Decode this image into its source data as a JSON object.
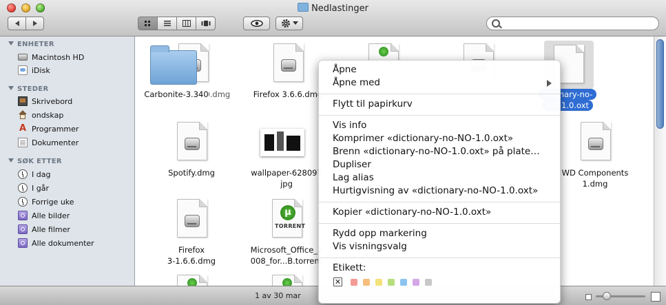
{
  "window": {
    "title": "Nedlastinger"
  },
  "toolbar": {
    "back_icon": "back-arrow",
    "forward_icon": "forward-arrow",
    "view_modes": [
      "icon-view",
      "list-view",
      "column-view",
      "coverflow-view"
    ],
    "active_view": "icon-view",
    "quicklook_icon": "eye",
    "action_icon": "gear",
    "search": {
      "value": "",
      "placeholder": ""
    }
  },
  "sidebar": {
    "sections": [
      {
        "heading": "ENHETER",
        "items": [
          {
            "label": "Macintosh HD",
            "icon": "hard-drive-icon"
          },
          {
            "label": "iDisk",
            "icon": "idisk-icon"
          }
        ]
      },
      {
        "heading": "STEDER",
        "items": [
          {
            "label": "Skrivebord",
            "icon": "desktop-icon"
          },
          {
            "label": "ondskap",
            "icon": "home-icon"
          },
          {
            "label": "Programmer",
            "icon": "applications-icon"
          },
          {
            "label": "Dokumenter",
            "icon": "documents-icon"
          }
        ]
      },
      {
        "heading": "SØK ETTER",
        "items": [
          {
            "label": "I dag",
            "icon": "clock-icon"
          },
          {
            "label": "I går",
            "icon": "clock-icon"
          },
          {
            "label": "Forrige uke",
            "icon": "clock-icon"
          },
          {
            "label": "Alle bilder",
            "icon": "smart-folder-icon"
          },
          {
            "label": "Alle filmer",
            "icon": "smart-folder-icon"
          },
          {
            "label": "Alle dokumenter",
            "icon": "smart-folder-icon"
          }
        ]
      }
    ]
  },
  "files": [
    {
      "label": "Adium_1.3.10.dmg",
      "kind": "dmg"
    },
    {
      "label": "Carbonite-3.340",
      "kind": "folder"
    },
    {
      "label": "Firefox 3.6.6.dmg",
      "kind": "dmg"
    },
    {
      "label": "dictionary-no-NO-1.0.oxt",
      "display_line1": "ictionary-no-",
      "display_line2": "NO-1.0.oxt",
      "kind": "blank",
      "selected": true
    },
    {
      "label": "Spotify.dmg",
      "kind": "dmg"
    },
    {
      "label": "wallpaper-628097",
      "label_line2": "jpg",
      "kind": "image"
    },
    {
      "label": "WD Components",
      "label_line2": "1.dmg",
      "kind": "dmg"
    },
    {
      "label": "Firefox",
      "label_line2": "3-1.6.6.dmg",
      "kind": "dmg"
    },
    {
      "label": "Microsoft_Office_2",
      "label_line2": "008_for...B.torrent",
      "kind": "torrent"
    }
  ],
  "torrent_badge": "TORRENT",
  "status": {
    "text": "1 av 30 mar"
  },
  "context_menu": {
    "groups": [
      [
        "Åpne",
        "Åpne med"
      ],
      [
        "Flytt til papirkurv"
      ],
      [
        "Vis info",
        "Komprimer «dictionary-no-NO-1.0.oxt»",
        "Brenn «dictionary-no-NO-1.0.oxt» på plate…",
        "Dupliser",
        "Lag alias",
        "Hurtigvisning av «dictionary-no-NO-1.0.oxt»"
      ],
      [
        "Kopier «dictionary-no-NO-1.0.oxt»"
      ],
      [
        "Rydd opp markering",
        "Vis visningsvalg"
      ]
    ],
    "label_heading": "Etikett:",
    "label_none": "✕",
    "label_colors": [
      "#f29b95",
      "#f7bf7c",
      "#f3e27b",
      "#b7de7d",
      "#8dc3f0",
      "#d5a6e6",
      "#c7c7c7"
    ]
  }
}
